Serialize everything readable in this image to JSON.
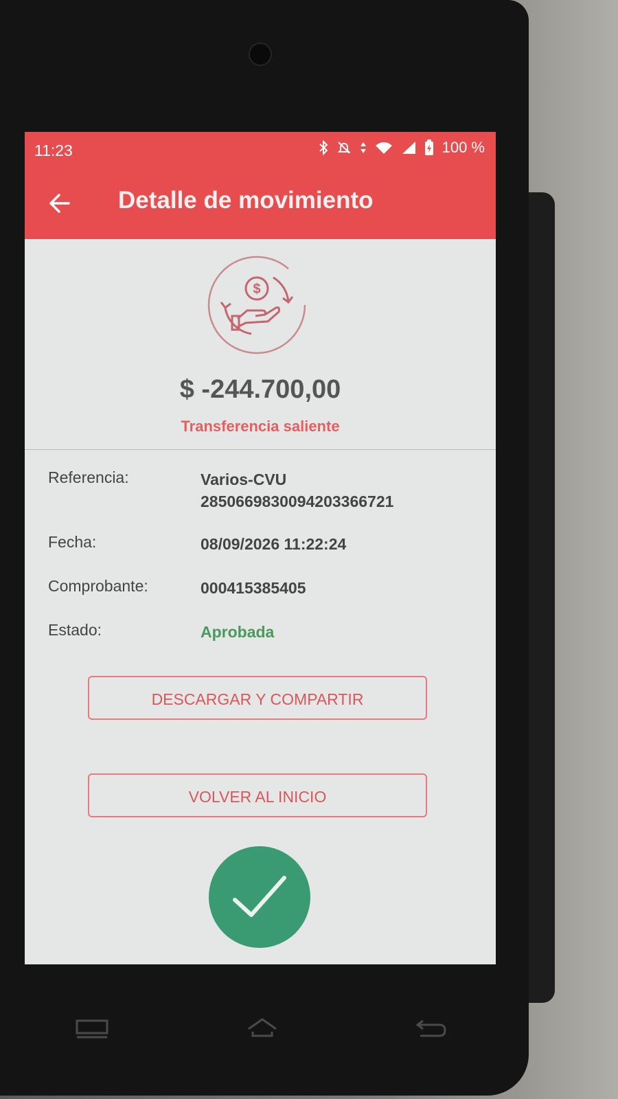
{
  "status_bar": {
    "time": "11:23",
    "battery": "100 %",
    "icons": [
      "bluetooth-icon",
      "mute-icon",
      "data-icon",
      "wifi-icon",
      "signal-icon",
      "battery-icon"
    ]
  },
  "app_bar": {
    "title": "Detalle de movimiento",
    "back_icon": "arrow-back-icon",
    "background": "#e74c4f"
  },
  "movement": {
    "amount": "$ -244.700,00",
    "type": "Transferencia saliente",
    "icon": "money-transfer-icon"
  },
  "details": [
    {
      "label": "Referencia:",
      "value": "Varios-CVU",
      "value2": "2850669830094203366721"
    },
    {
      "label": "Fecha:",
      "value": "08/09/2026 11:22:24"
    },
    {
      "label": "Comprobante:",
      "value": "000415385405"
    },
    {
      "label": "Estado:",
      "value": "Aprobada",
      "value_color": "#4a9a5b"
    }
  ],
  "buttons": {
    "download_share": "DESCARGAR Y COMPARTIR",
    "back_home": "VOLVER AL INICIO"
  },
  "fab": {
    "icon": "check-icon",
    "color": "#3a9b72"
  },
  "nav": [
    "recents-icon",
    "home-icon",
    "back-icon"
  ]
}
